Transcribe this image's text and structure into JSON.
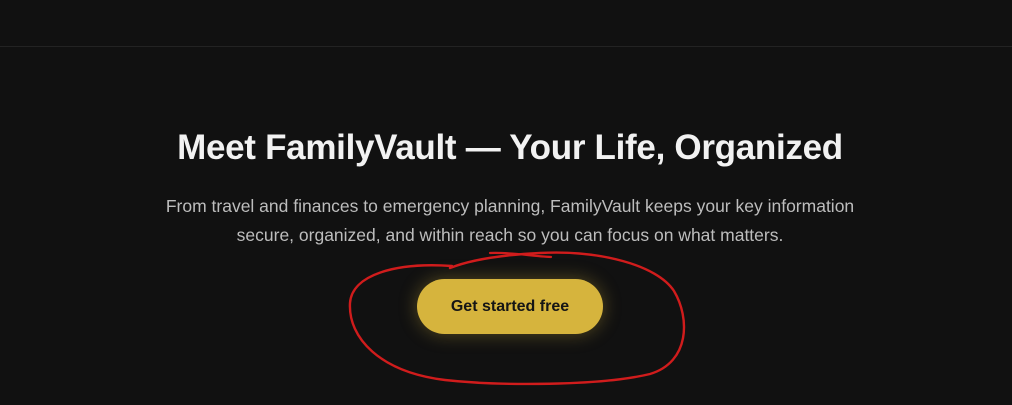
{
  "hero": {
    "title": "Meet FamilyVault — Your Life, Organized",
    "description_line1": "From travel and finances to emergency planning, FamilyVault keeps your key information",
    "description_line2": "secure, organized, and within reach so you can focus on what matters.",
    "cta_label": "Get started free"
  },
  "colors": {
    "background": "#111111",
    "accent": "#d6b43d",
    "annotation": "#d01c1c"
  }
}
